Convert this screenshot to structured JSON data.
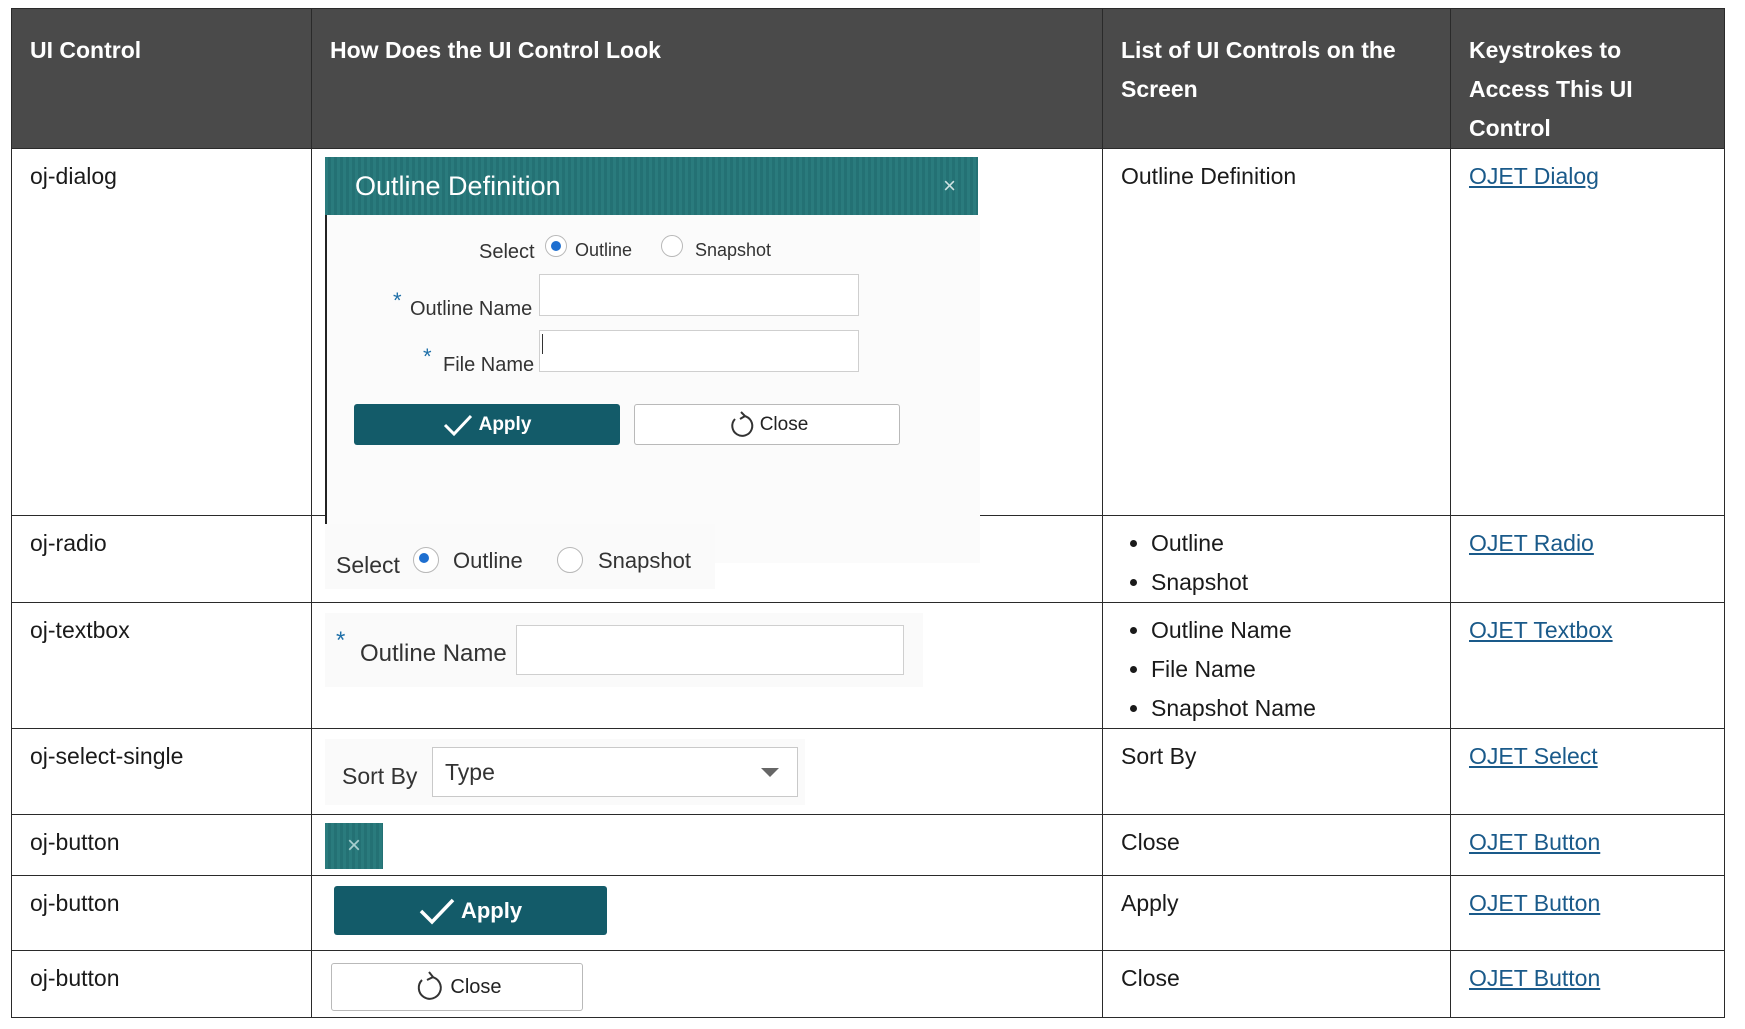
{
  "table": {
    "headers": [
      "UI Control",
      "How Does the UI Control Look",
      "List of UI Controls on the Screen",
      "Keystrokes to Access This UI Control"
    ],
    "rows": [
      {
        "control": "oj-dialog",
        "list": "Outline Definition",
        "link": "OJET Dialog"
      },
      {
        "control": "oj-radio",
        "list_items": [
          "Outline",
          "Snapshot"
        ],
        "link": "OJET Radio"
      },
      {
        "control": "oj-textbox",
        "list_items": [
          "Outline Name",
          "File Name",
          "Snapshot Name"
        ],
        "link": "OJET Textbox"
      },
      {
        "control": "oj-select-single",
        "list": "Sort By",
        "link": "OJET Select"
      },
      {
        "control": "oj-button",
        "list": "Close",
        "link": "OJET Button"
      },
      {
        "control": "oj-button",
        "list": "Apply",
        "link": "OJET Button"
      },
      {
        "control": "oj-button",
        "list": "Close",
        "link": "OJET Button"
      }
    ]
  },
  "mockups": {
    "dialog": {
      "title": "Outline Definition",
      "close_glyph": "×",
      "select_label": "Select",
      "radio_outline": "Outline",
      "radio_snapshot": "Snapshot",
      "required_mark": "*",
      "outline_name_label": "Outline Name",
      "file_name_label": "File Name",
      "apply": "Apply",
      "close": "Close"
    },
    "radio": {
      "select_label": "Select",
      "outline": "Outline",
      "snapshot": "Snapshot"
    },
    "textbox": {
      "required_mark": "*",
      "label": "Outline Name"
    },
    "select": {
      "label": "Sort By",
      "value": "Type"
    },
    "close_x": "×",
    "apply": "Apply",
    "close": "Close",
    "icons": {
      "check": "check-icon",
      "refresh": "refresh-icon",
      "caret": "chevron-down-icon"
    },
    "colors": {
      "teal": "#1e6f72",
      "button": "#135b69",
      "header": "#4a4a4a",
      "radio": "#1e6fd0",
      "link": "#1a5a8a"
    }
  }
}
